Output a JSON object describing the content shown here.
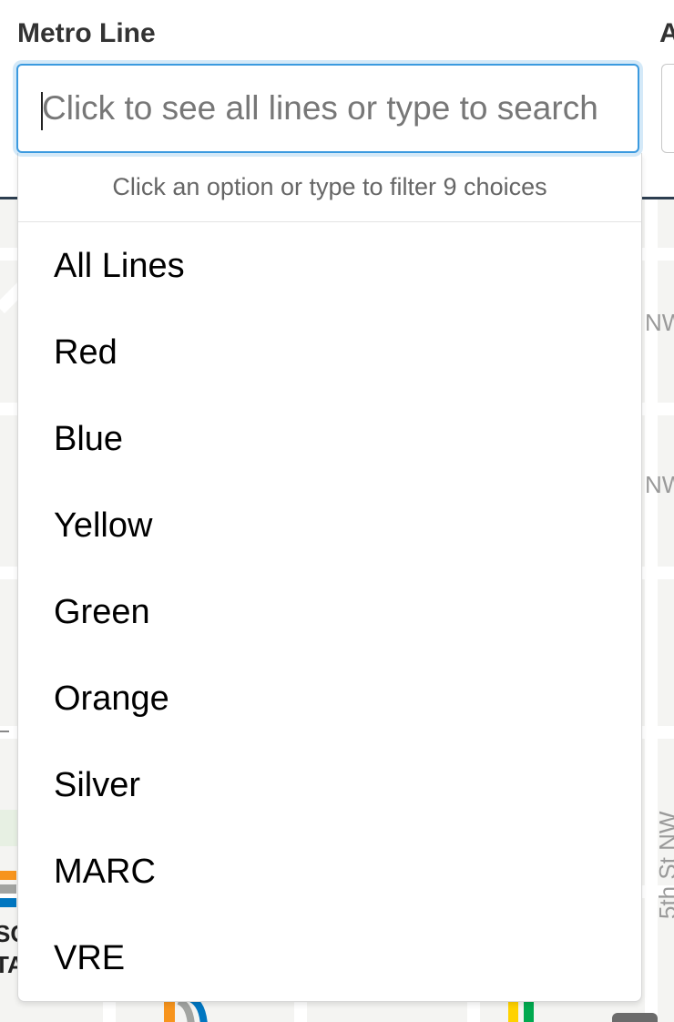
{
  "form": {
    "metro_line_label": "Metro Line",
    "second_label": "A"
  },
  "search": {
    "placeholder": "Click to see all lines or type to search",
    "value": ""
  },
  "dropdown": {
    "hint": "Click an option or type to filter 9 choices",
    "options": [
      "All Lines",
      "Red",
      "Blue",
      "Yellow",
      "Green",
      "Orange",
      "Silver",
      "MARC",
      "VRE"
    ]
  },
  "map": {
    "street_nw_1": "NW",
    "street_nw_2": "NW",
    "street_5th": "5th St NW",
    "station_text_1": "SC",
    "station_text_2": "TA"
  },
  "colors": {
    "focus_border": "#3b9adf",
    "header_bar": "#2d3e50",
    "line_orange": "#f7941d",
    "line_silver": "#a2a4a1",
    "line_blue": "#0076c0",
    "line_yellow": "#ffd200",
    "line_green": "#00a94f"
  }
}
